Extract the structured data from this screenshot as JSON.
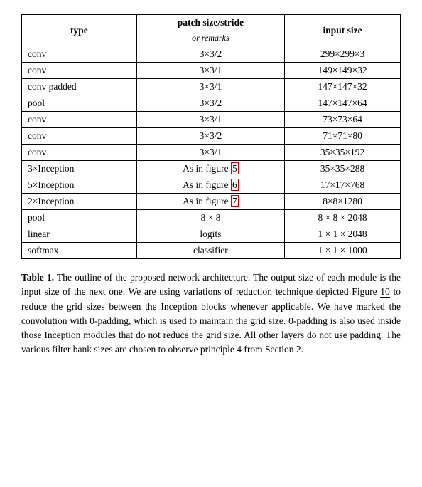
{
  "table": {
    "headers": {
      "col1": "type",
      "col2_main": "patch size/stride",
      "col2_sub": "or remarks",
      "col3": "input size"
    },
    "rows": [
      {
        "type": "conv",
        "patch": "3×3/2",
        "input": "299×299×3"
      },
      {
        "type": "conv",
        "patch": "3×3/1",
        "input": "149×149×32"
      },
      {
        "type": "conv padded",
        "patch": "3×3/1",
        "input": "147×147×32"
      },
      {
        "type": "pool",
        "patch": "3×3/2",
        "input": "147×147×64"
      },
      {
        "type": "conv",
        "patch": "3×3/1",
        "input": "73×73×64"
      },
      {
        "type": "conv",
        "patch": "3×3/2",
        "input": "71×71×80"
      },
      {
        "type": "conv",
        "patch": "3×3/1",
        "input": "35×35×192"
      },
      {
        "type": "3×Inception",
        "patch": "As in figure 5",
        "input": "35×35×288",
        "highlight": "5"
      },
      {
        "type": "5×Inception",
        "patch": "As in figure 6",
        "input": "17×17×768",
        "highlight": "6"
      },
      {
        "type": "2×Inception",
        "patch": "As in figure 7",
        "input": "8×8×1280",
        "highlight": "7"
      },
      {
        "type": "pool",
        "patch": "8 × 8",
        "input": "8 × 8 × 2048"
      },
      {
        "type": "linear",
        "patch": "logits",
        "input": "1 × 1 × 2048"
      },
      {
        "type": "softmax",
        "patch": "classifier",
        "input": "1 × 1 × 1000"
      }
    ]
  },
  "caption": {
    "label": "Table 1.",
    "text": " The outline of the proposed network architecture.  The output size of each module is the input size of the next one.  We are using variations of reduction technique depicted Figure ",
    "ref10": "10",
    "text2": " to reduce the grid sizes between the Inception blocks whenever applicable.  We have marked the convolution with 0-padding, which is used to maintain the grid size.  0-padding is also used inside those Inception modules that do not reduce the grid size.  All other layers do not use padding.  The various filter bank sizes are chosen to observe principle ",
    "ref4": "4",
    "text3": " from Section ",
    "ref2": "2",
    "text4": "."
  }
}
